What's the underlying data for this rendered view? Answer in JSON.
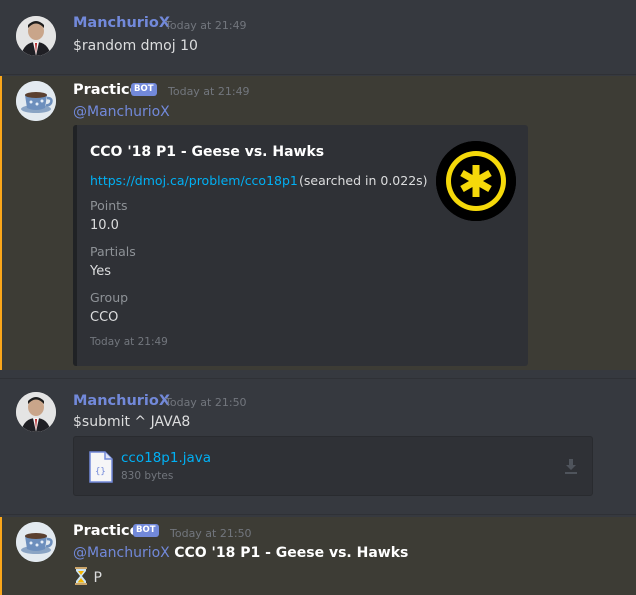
{
  "messages": {
    "m1": {
      "author": "ManchurioX",
      "time": "Today at 21:49",
      "text": "$random dmoj 10"
    },
    "m2": {
      "author": "Practice",
      "badge": "BOT",
      "time": "Today at 21:49",
      "mention": "@ManchurioX",
      "embed": {
        "title": "CCO '18 P1 - Geese vs. Hawks",
        "link": "https://dmoj.ca/problem/cco18p1",
        "searched": "(searched in 0.022s)",
        "fields": [
          {
            "name": "Points",
            "value": "10.0"
          },
          {
            "name": "Partials",
            "value": "Yes"
          },
          {
            "name": "Group",
            "value": "CCO"
          }
        ],
        "footer": "Today at 21:49"
      }
    },
    "m3": {
      "author": "ManchurioX",
      "time": "Today at 21:50",
      "text": "$submit ^ JAVA8",
      "attachment": {
        "name": "cco18p1.java",
        "size": "830 bytes"
      }
    },
    "m4": {
      "author": "Practice",
      "badge": "BOT",
      "time": "Today at 21:50",
      "mention": "@ManchurioX",
      "problem": "CCO '18 P1 - Geese vs. Hawks",
      "status_icon": "hourglass-icon",
      "status": "P"
    }
  },
  "colors": {
    "background": "#36393f",
    "mention_highlight": "#faa61a",
    "link": "#00b0f4",
    "user_name": "#7289da"
  }
}
